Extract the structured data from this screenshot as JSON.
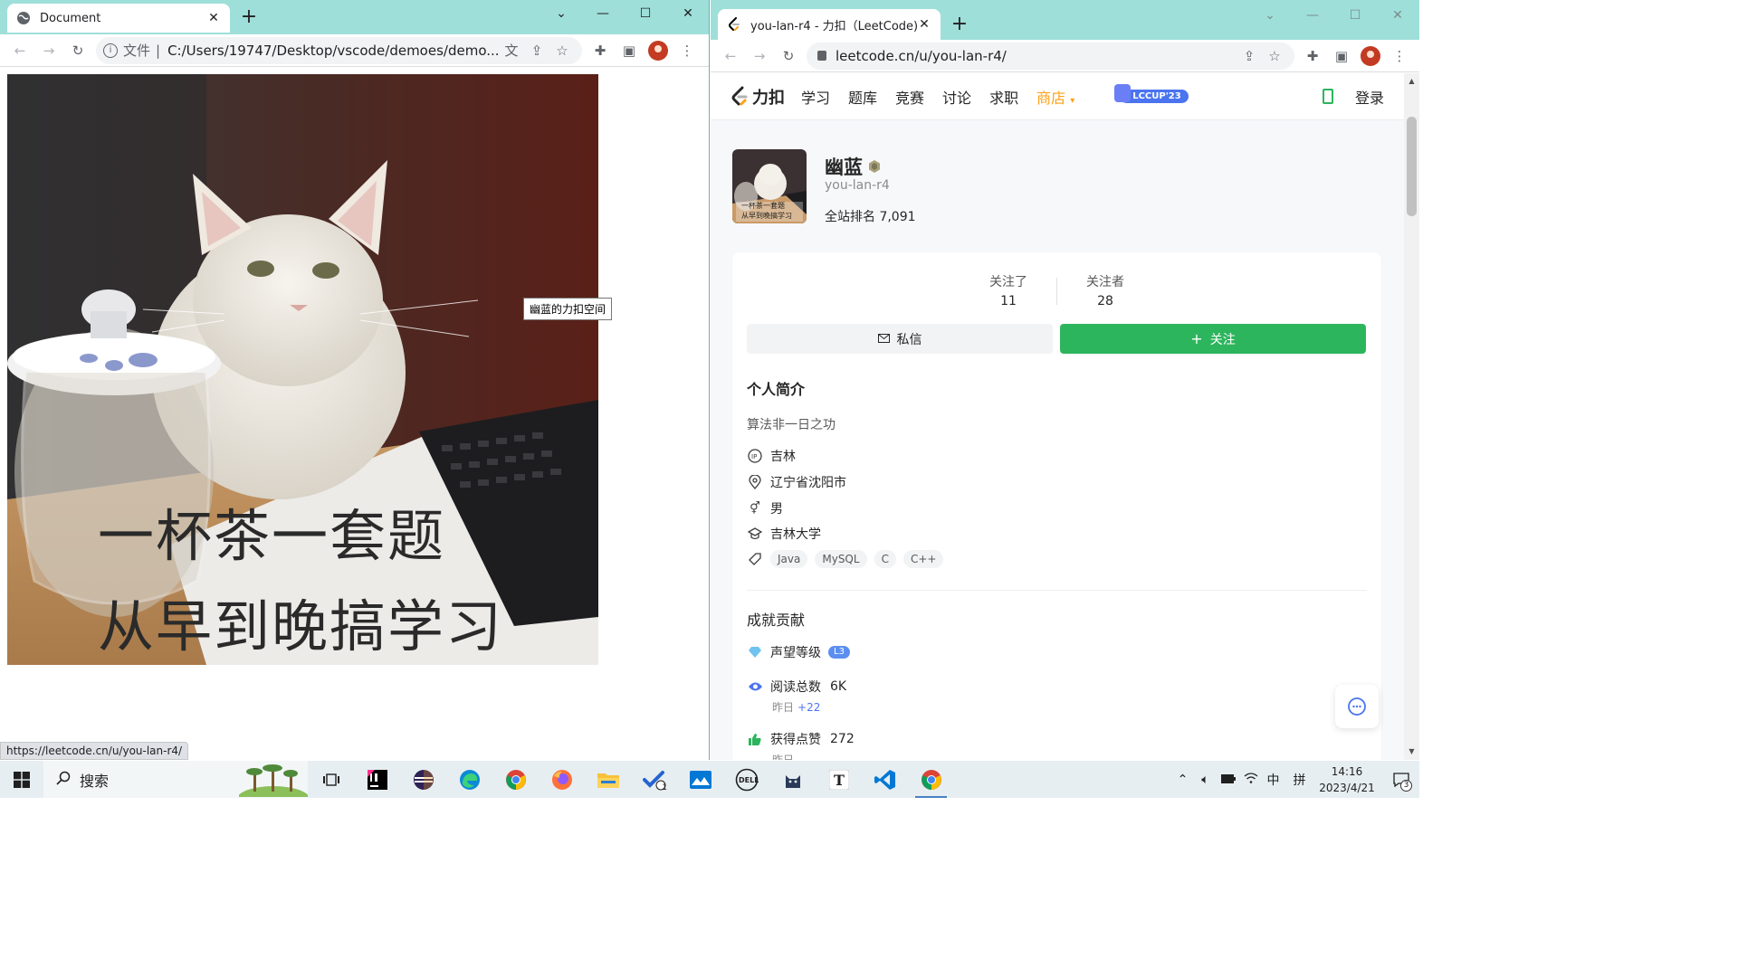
{
  "left_window": {
    "tab_title": "Document",
    "omnibox": {
      "prefix": "文件",
      "separator": "|",
      "url": "C:/Users/19747/Desktop/vscode/demoes/demo..."
    },
    "image_caption": [
      "一杯茶一套题",
      "从早到晚搞学习"
    ],
    "tooltip": "幽蓝的力扣空间",
    "status_url": "https://leetcode.cn/u/you-lan-r4/"
  },
  "right_window": {
    "tab_title": "you-lan-r4 - 力扣（LeetCode)",
    "omnibox": {
      "url": "leetcode.cn/u/you-lan-r4/"
    },
    "nav": {
      "logo_text": "力扣",
      "items": [
        "学习",
        "题库",
        "竞赛",
        "讨论",
        "求职",
        "商店"
      ],
      "lccup": "LCCUP'23",
      "login": "登录"
    },
    "profile": {
      "name": "幽蓝",
      "handle": "you-lan-r4",
      "rank_label": "全站排名",
      "rank_value": "7,091",
      "avatar_caption": [
        "一杯茶一套题",
        "从早到晚搞学习"
      ]
    },
    "stats": {
      "following_label": "关注了",
      "following_value": "11",
      "followers_label": "关注者",
      "followers_value": "28"
    },
    "buttons": {
      "message": "私信",
      "follow": "关注"
    },
    "about": {
      "title": "个人简介",
      "bio": "算法非一日之功",
      "location_origin": "吉林",
      "location_city": "辽宁省沈阳市",
      "gender": "男",
      "school": "吉林大学",
      "tags": [
        "Java",
        "MySQL",
        "C",
        "C++"
      ]
    },
    "achievements": {
      "title": "成就贡献",
      "reputation_label": "声望等级",
      "reputation_level": "L3",
      "reads_label": "阅读总数",
      "reads_value": "6K",
      "reads_yesterday_label": "昨日",
      "reads_yesterday_delta": "+22",
      "likes_label": "获得点赞",
      "likes_value": "272",
      "likes_yesterday_label": "昨日"
    }
  },
  "taskbar": {
    "search_label": "搜索",
    "ime_lang": "中",
    "ime_mode": "拼",
    "time": "14:16",
    "date": "2023/4/21",
    "notification_count": "3",
    "todo_badge": "1"
  },
  "colors": {
    "titlebar": "#9fdfd9",
    "leetcode_orange": "#ffa116",
    "follow_green": "#2db55d",
    "accent_blue": "#4a74f0",
    "taskbar": "#e6eef2"
  },
  "icons": [
    "chrome-icon",
    "back-icon",
    "forward-icon",
    "reload-icon",
    "info-icon",
    "translate-icon",
    "share-icon",
    "star-icon",
    "extensions-icon",
    "sidepanel-icon",
    "profile-avatar",
    "menu-icon",
    "lock-icon",
    "leetcode-logo",
    "phone-icon",
    "mail-icon",
    "plus-icon",
    "location-icon",
    "gender-icon",
    "school-icon",
    "tag-icon",
    "diamond-icon",
    "eye-icon",
    "thumbs-up-icon",
    "chat-icon",
    "windows-start-icon",
    "search-icon"
  ]
}
